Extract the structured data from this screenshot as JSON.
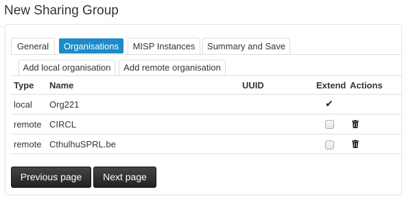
{
  "page": {
    "title": "New Sharing Group"
  },
  "tabs": [
    {
      "label": "General",
      "active": false
    },
    {
      "label": "Organisations",
      "active": true
    },
    {
      "label": "MISP Instances",
      "active": false
    },
    {
      "label": "Summary and Save",
      "active": false
    }
  ],
  "subtabs": [
    {
      "label": "Add local organisation"
    },
    {
      "label": "Add remote organisation"
    }
  ],
  "table": {
    "headers": {
      "type": "Type",
      "name": "Name",
      "uuid": "UUID",
      "extend": "Extend",
      "actions": "Actions"
    },
    "rows": [
      {
        "type": "local",
        "name": "Org221",
        "uuid": "",
        "extend": true,
        "extend_editable": false,
        "deletable": false
      },
      {
        "type": "remote",
        "name": "CIRCL",
        "uuid": "",
        "extend": false,
        "extend_editable": true,
        "deletable": true
      },
      {
        "type": "remote",
        "name": "CthulhuSPRL.be",
        "uuid": "",
        "extend": false,
        "extend_editable": true,
        "deletable": true
      }
    ]
  },
  "buttons": {
    "previous": "Previous page",
    "next": "Next page"
  },
  "colors": {
    "active_tab": "#1e8ac9",
    "button_bg": "#2b2b2b"
  },
  "icons": {
    "check": "checkmark-icon",
    "delete": "trash-icon"
  }
}
